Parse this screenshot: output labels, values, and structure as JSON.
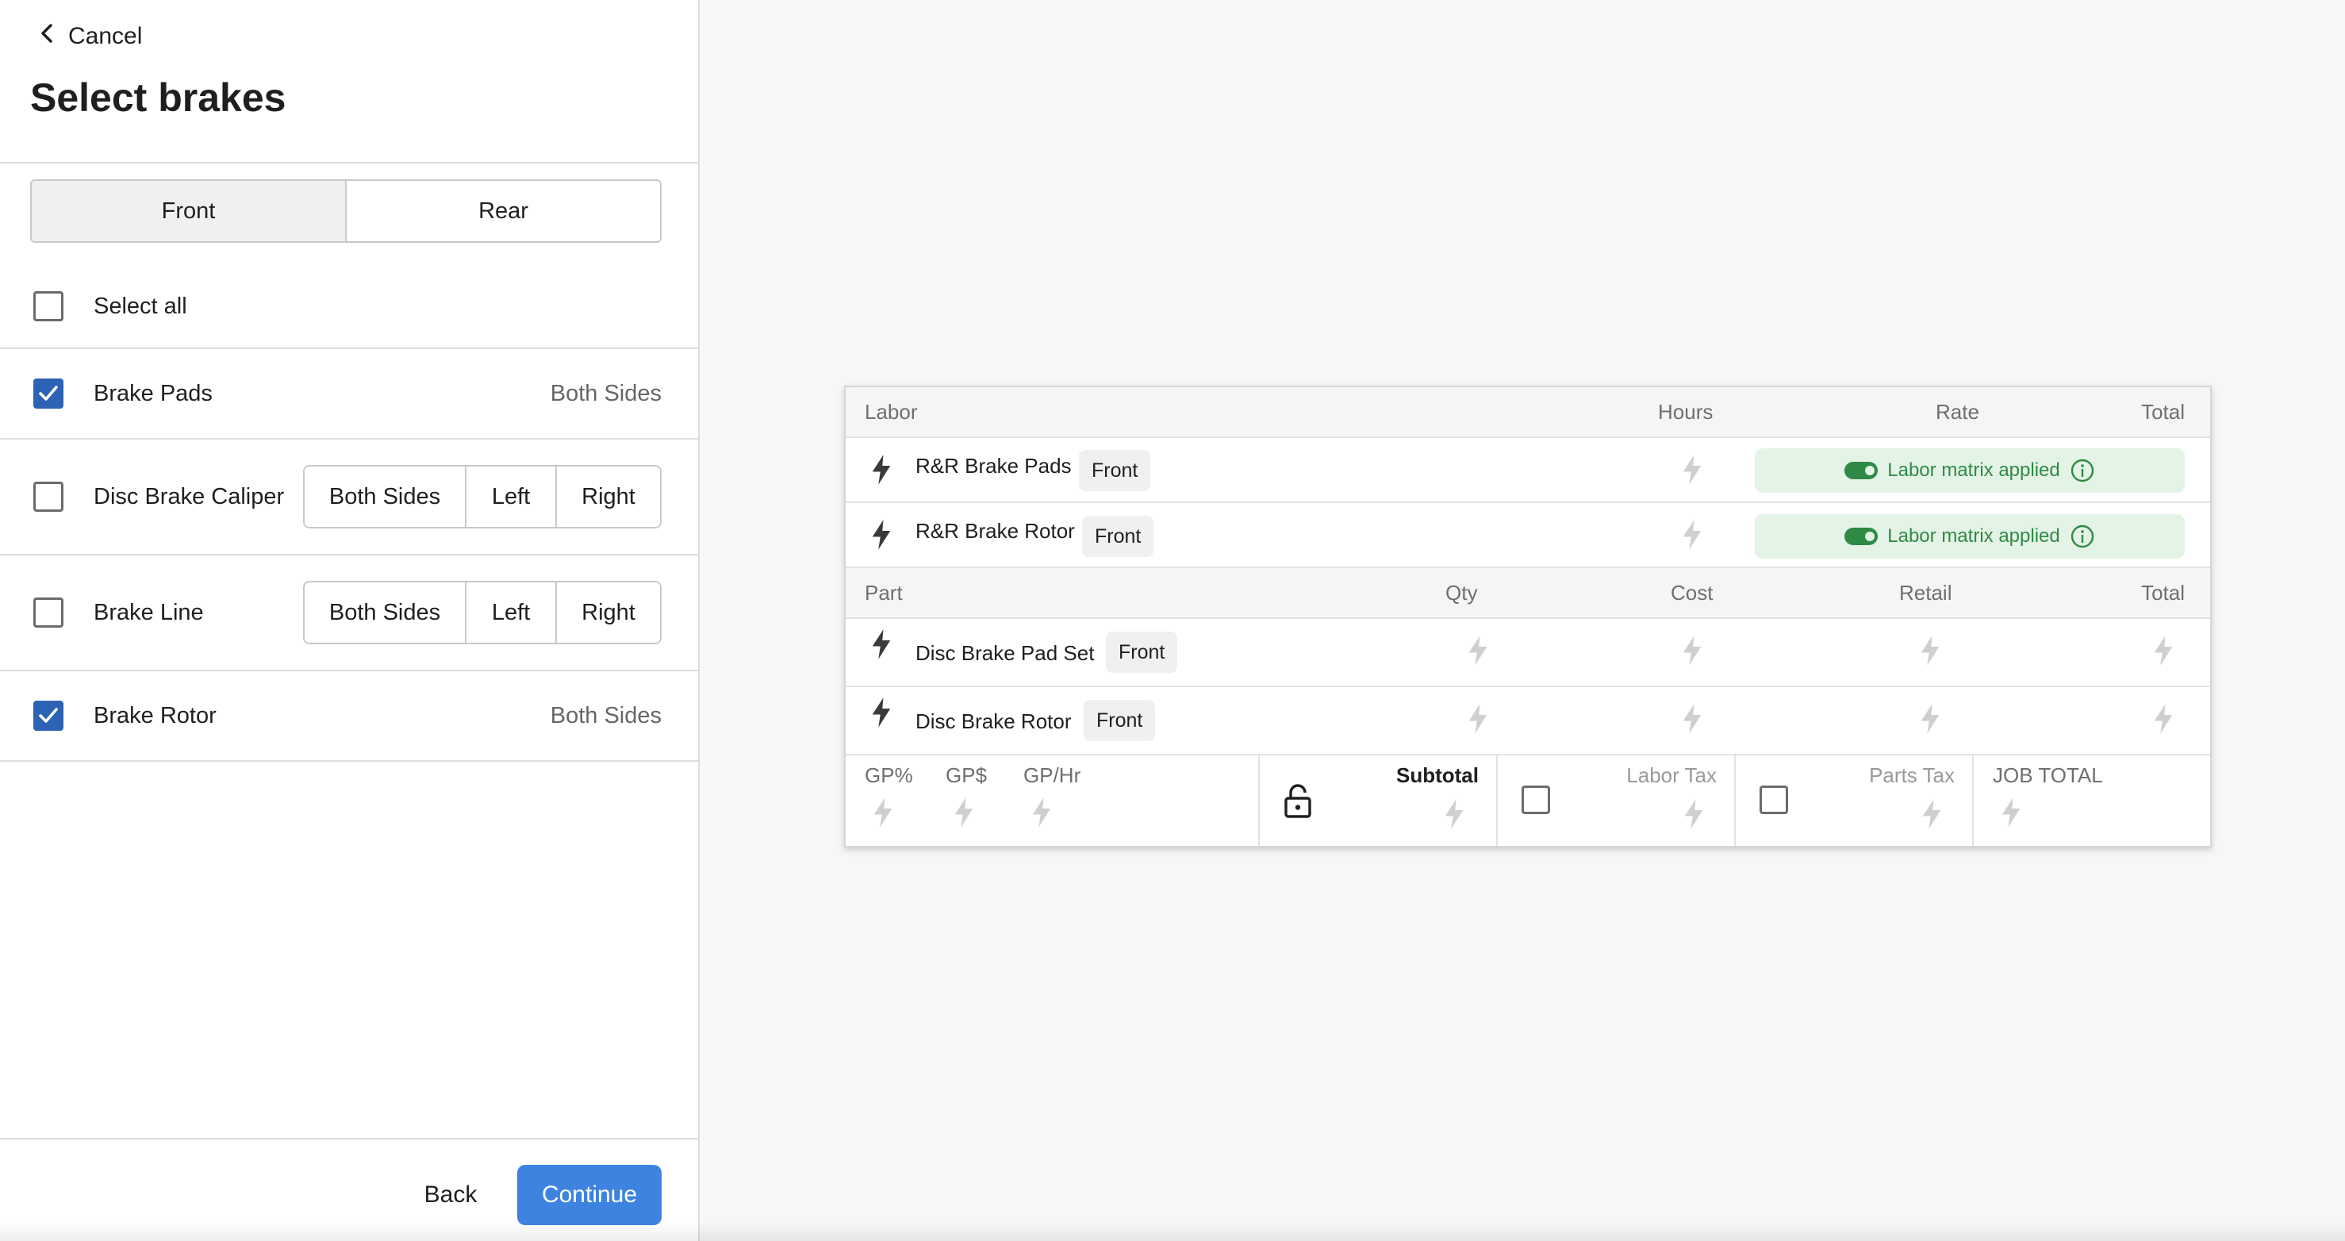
{
  "panel": {
    "cancel_label": "Cancel",
    "title": "Select brakes",
    "tabs": [
      {
        "label": "Front",
        "active": true
      },
      {
        "label": "Rear",
        "active": false
      }
    ],
    "select_all_label": "Select all",
    "items": [
      {
        "label": "Brake Pads",
        "checked": true,
        "value": "Both Sides"
      },
      {
        "label": "Disc Brake Caliper",
        "checked": false,
        "options": [
          "Both Sides",
          "Left",
          "Right"
        ]
      },
      {
        "label": "Brake Line",
        "checked": false,
        "options": [
          "Both Sides",
          "Left",
          "Right"
        ]
      },
      {
        "label": "Brake Rotor",
        "checked": true,
        "value": "Both Sides"
      }
    ],
    "back_label": "Back",
    "continue_label": "Continue"
  },
  "estimate": {
    "labor_headers": [
      "Labor",
      "Hours",
      "Rate",
      "Total"
    ],
    "labor_rows": [
      {
        "name": "R&R Brake Pads",
        "position": "Front",
        "matrix": "Labor matrix applied"
      },
      {
        "name": "R&R Brake Rotor",
        "position": "Front",
        "matrix": "Labor matrix applied"
      }
    ],
    "part_headers": [
      "Part",
      "Qty",
      "Cost",
      "Retail",
      "Total"
    ],
    "part_rows": [
      {
        "name": "Disc Brake Pad Set",
        "position": "Front"
      },
      {
        "name": "Disc Brake Rotor",
        "position": "Front"
      }
    ],
    "summary": {
      "gp_percent": "GP%",
      "gp_dollar": "GP$",
      "gp_hr": "GP/Hr",
      "subtotal": "Subtotal",
      "labor_tax": "Labor Tax",
      "parts_tax": "Parts Tax",
      "job_total": "JOB TOTAL"
    }
  },
  "colors": {
    "accent": "#3f83e0",
    "checkbox": "#2d63b4",
    "matrix_bg": "#e3f3e6",
    "matrix_text": "#2f8a45"
  },
  "icons": {
    "bolt": "bolt-icon",
    "lock": "unlocked-padlock-icon",
    "info": "info-circle-icon",
    "back": "chevron-left-icon"
  }
}
